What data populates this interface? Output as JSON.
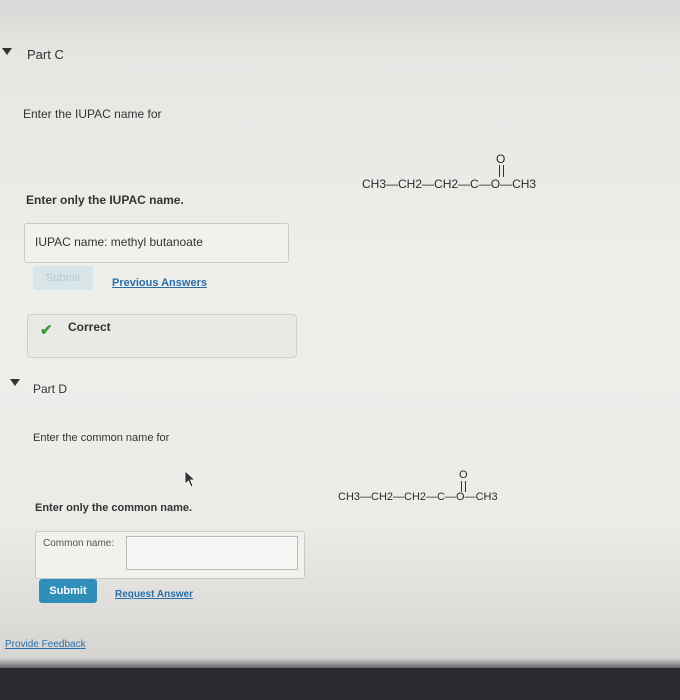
{
  "part_c": {
    "title": "Part C",
    "prompt": "Enter the IUPAC name for",
    "instruction": "Enter only the IUPAC name.",
    "answer": "IUPAC name: methyl butanoate",
    "submit_label": "Submit",
    "previous_answers_label": "Previous Answers",
    "feedback": "Correct",
    "formula": {
      "groups": [
        "CH3",
        "CH2",
        "CH2",
        "C",
        "O",
        "CH3"
      ],
      "carbonyl_o": "O"
    }
  },
  "part_d": {
    "title": "Part D",
    "prompt": "Enter the common name for",
    "instruction": "Enter only the common name.",
    "input_label": "Common name:",
    "input_value": "",
    "submit_label": "Submit",
    "request_answer_label": "Request Answer",
    "formula": {
      "groups": [
        "CH3",
        "CH2",
        "CH2",
        "C",
        "O",
        "CH3"
      ],
      "carbonyl_o": "O"
    }
  },
  "footer": {
    "feedback_link": "Provide Feedback"
  },
  "colors": {
    "accent": "#2f8fb8",
    "correct_check": "#3a9a3a",
    "link": "#2a6ea8"
  }
}
